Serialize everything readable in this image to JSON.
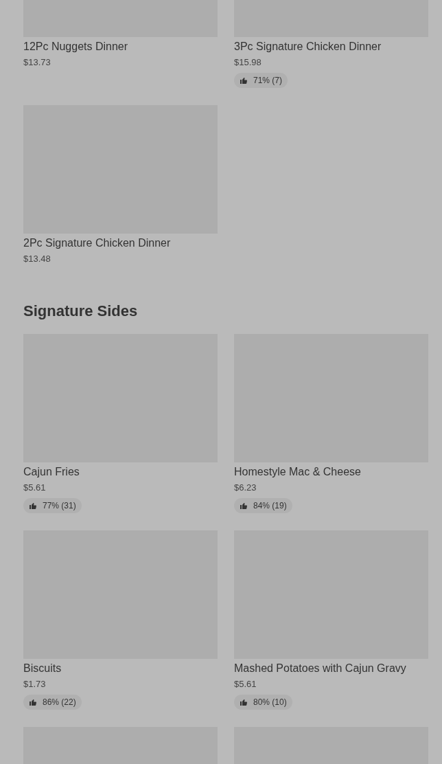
{
  "sections": [
    {
      "items": [
        {
          "kind": "dish",
          "name": "12Pc Nuggets Dinner",
          "price": "$13.73"
        },
        {
          "kind": "dish",
          "name": "3Pc Signature Chicken Dinner",
          "price": "$15.98",
          "rating": "71% (7)"
        },
        {
          "kind": "dish",
          "name": "2Pc Signature Chicken Dinner",
          "price": "$13.48"
        }
      ]
    },
    {
      "title": "Signature Sides",
      "items": [
        {
          "kind": "dish",
          "name": "Cajun Fries",
          "price": "$5.61",
          "rating": "77% (31)"
        },
        {
          "kind": "dish",
          "name": "Homestyle Mac & Cheese",
          "price": "$6.23",
          "rating": "84% (19)"
        },
        {
          "kind": "dish",
          "name": "Biscuits",
          "price": "$1.73",
          "rating": "86% (22)"
        },
        {
          "kind": "dish",
          "name": "Mashed Potatoes with Cajun Gravy",
          "price": "$5.61",
          "rating": "80% (10)"
        },
        {
          "kind": "image_only"
        },
        {
          "kind": "image_only"
        }
      ]
    }
  ]
}
